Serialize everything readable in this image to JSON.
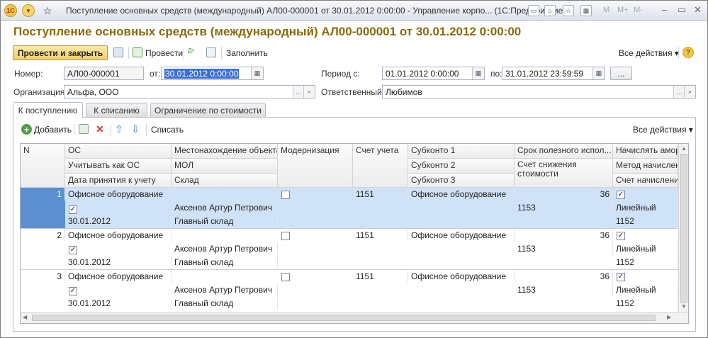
{
  "window": {
    "title": "Поступление основных средств (международный) АЛ00-000001 от 30.01.2012 0:00:00 - Управление корпо...  (1С:Предприятие)",
    "logo": "1С",
    "mplus": [
      "M",
      "M+",
      "M-"
    ]
  },
  "doc": {
    "title": "Поступление основных средств (международный) АЛ00-000001 от 30.01.2012 0:00:00"
  },
  "toolbar": {
    "post_close": "Провести и закрыть",
    "post": "Провести",
    "fill": "Заполнить",
    "all_actions": "Все действия"
  },
  "form": {
    "number_label": "Номер:",
    "number": "АЛ00-000001",
    "date_label": "от:",
    "date": "30.01.2012  0:00:00",
    "period_label": "Период с:",
    "period_from": "01.01.2012  0:00:00",
    "period_to_label": "по:",
    "period_to": "31.01.2012 23:59:59",
    "period_btn": "...",
    "org_label": "Организация:",
    "org": "Альфа, ООО",
    "resp_label": "Ответственный:",
    "resp": "Любимов"
  },
  "tabs": [
    "К поступлению",
    "К списанию",
    "Ограничение по стоимости"
  ],
  "table_toolbar": {
    "add": "Добавить",
    "writeoff": "Списать",
    "all_actions": "Все действия"
  },
  "table": {
    "headers": {
      "n": "N",
      "os": "ОС",
      "use_as_os": "Учитывать как ОС",
      "accept_date": "Дата принятия к учету",
      "location": "Местонахождение объекта",
      "mol": "МОЛ",
      "warehouse": "Склад",
      "modern": "Модернизация",
      "account": "Счет учета",
      "sub1": "Субконто 1",
      "sub2": "Субконто 2",
      "sub3": "Субконто 3",
      "life": "Срок полезного испол...",
      "reduce_acc": "Счет снижения стоимости",
      "accrue": "Начислять аморт...",
      "method": "Метод начислени...",
      "accrual_acc": "Счет начисления а..."
    },
    "rows": [
      {
        "n": "1",
        "os": "Офисное оборудование",
        "use": true,
        "date": "30.01.2012",
        "mol": "Аксенов Артур Петрович",
        "wh": "Главный склад",
        "modern": false,
        "acc": "1151",
        "sub1": "Офисное оборудование",
        "life": "36",
        "reduce": "1153",
        "accrue": true,
        "method": "Линейный",
        "accrual": "1152"
      },
      {
        "n": "2",
        "os": "Офисное оборудование",
        "use": true,
        "date": "30.01.2012",
        "mol": "Аксенов Артур Петрович",
        "wh": "Главный склад",
        "modern": false,
        "acc": "1151",
        "sub1": "Офисное оборудование",
        "life": "36",
        "reduce": "1153",
        "accrue": true,
        "method": "Линейный",
        "accrual": "1152"
      },
      {
        "n": "3",
        "os": "Офисное оборудование",
        "use": true,
        "date": "30.01.2012",
        "mol": "Аксенов Артур Петрович",
        "wh": "Главный склад",
        "modern": false,
        "acc": "1151",
        "sub1": "Офисное оборудование",
        "life": "36",
        "reduce": "1153",
        "accrue": true,
        "method": "Линейный",
        "accrual": "1152"
      }
    ]
  },
  "colors": {
    "accent": "#8a6a0a",
    "selected_row": "#cfe2f7",
    "selected_n": "#5b8fd0",
    "primary_btn": "#f0cf6c"
  }
}
